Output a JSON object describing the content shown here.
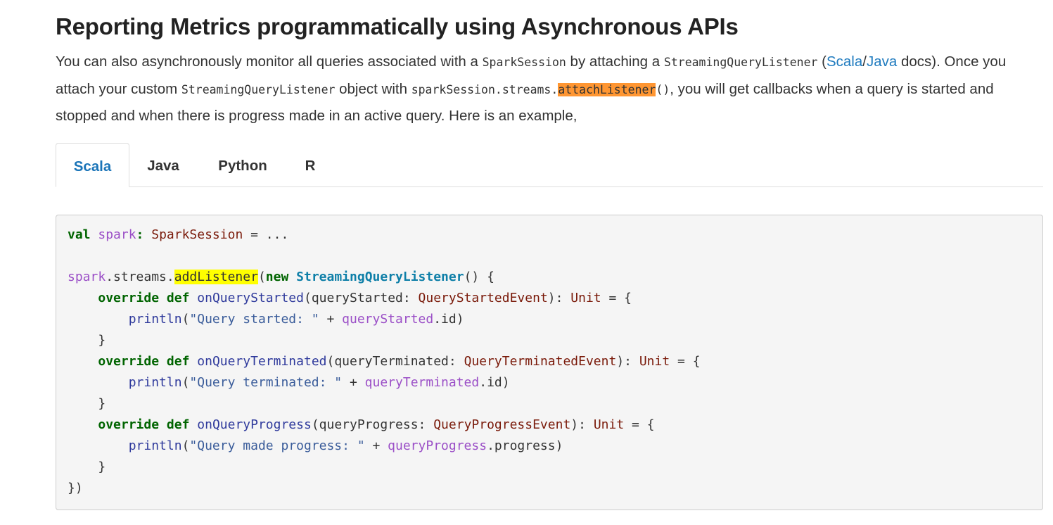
{
  "heading": "Reporting Metrics programmatically using Asynchronous APIs",
  "paragraph": {
    "t1": "You can also asynchronously monitor all queries associated with a ",
    "c1": "SparkSession",
    "t2": " by attaching a ",
    "c2": "StreamingQueryListener",
    "t3": " (",
    "link_scala": "Scala",
    "sep": "/",
    "link_java": "Java",
    "t4": " docs). Once you attach your custom ",
    "c3": "StreamingQueryListener",
    "t5": " object with ",
    "c4a": "sparkSession.streams.",
    "c4b": "attachListener",
    "c4c": "()",
    "t6": ", you will get callbacks when a query is started and stopped and when there is progress made in an active query. Here is an example,"
  },
  "tabs": [
    {
      "label": "Scala",
      "active": true
    },
    {
      "label": "Java",
      "active": false
    },
    {
      "label": "Python",
      "active": false
    },
    {
      "label": "R",
      "active": false
    }
  ],
  "code": {
    "l1": {
      "kw": "val",
      "var": "spark",
      "colon": ": ",
      "type": "SparkSession",
      "rest": " = ..."
    },
    "l3": {
      "obj": "spark",
      "dot": ".streams.",
      "method": "addListener",
      "open": "(",
      "kw": "new",
      "cls": "StreamingQueryListener",
      "rest": "() {"
    },
    "l4": {
      "kw1": "override",
      "kw2": "def",
      "fn": "onQueryStarted",
      "param": "(queryStarted: ",
      "type": "QueryStartedEvent",
      "mid": "): ",
      "type2": "Unit",
      "rest": " = {"
    },
    "l5": {
      "fn": "println",
      "open": "(",
      "str": "\"Query started: \"",
      "plus": " + ",
      "var": "queryStarted",
      "rest": ".id)"
    },
    "l6": "}",
    "l7": {
      "kw1": "override",
      "kw2": "def",
      "fn": "onQueryTerminated",
      "param": "(queryTerminated: ",
      "type": "QueryTerminatedEvent",
      "mid": "): ",
      "type2": "Unit",
      "rest": " = {"
    },
    "l8": {
      "fn": "println",
      "open": "(",
      "str": "\"Query terminated: \"",
      "plus": " + ",
      "var": "queryTerminated",
      "rest": ".id)"
    },
    "l9": "}",
    "l10": {
      "kw1": "override",
      "kw2": "def",
      "fn": "onQueryProgress",
      "param": "(queryProgress: ",
      "type": "QueryProgressEvent",
      "mid": "): ",
      "type2": "Unit",
      "rest": " = {"
    },
    "l11": {
      "fn": "println",
      "open": "(",
      "str": "\"Query made progress: \"",
      "plus": " + ",
      "var": "queryProgress",
      "rest": ".progress)"
    },
    "l12": "}",
    "l13": "})"
  }
}
